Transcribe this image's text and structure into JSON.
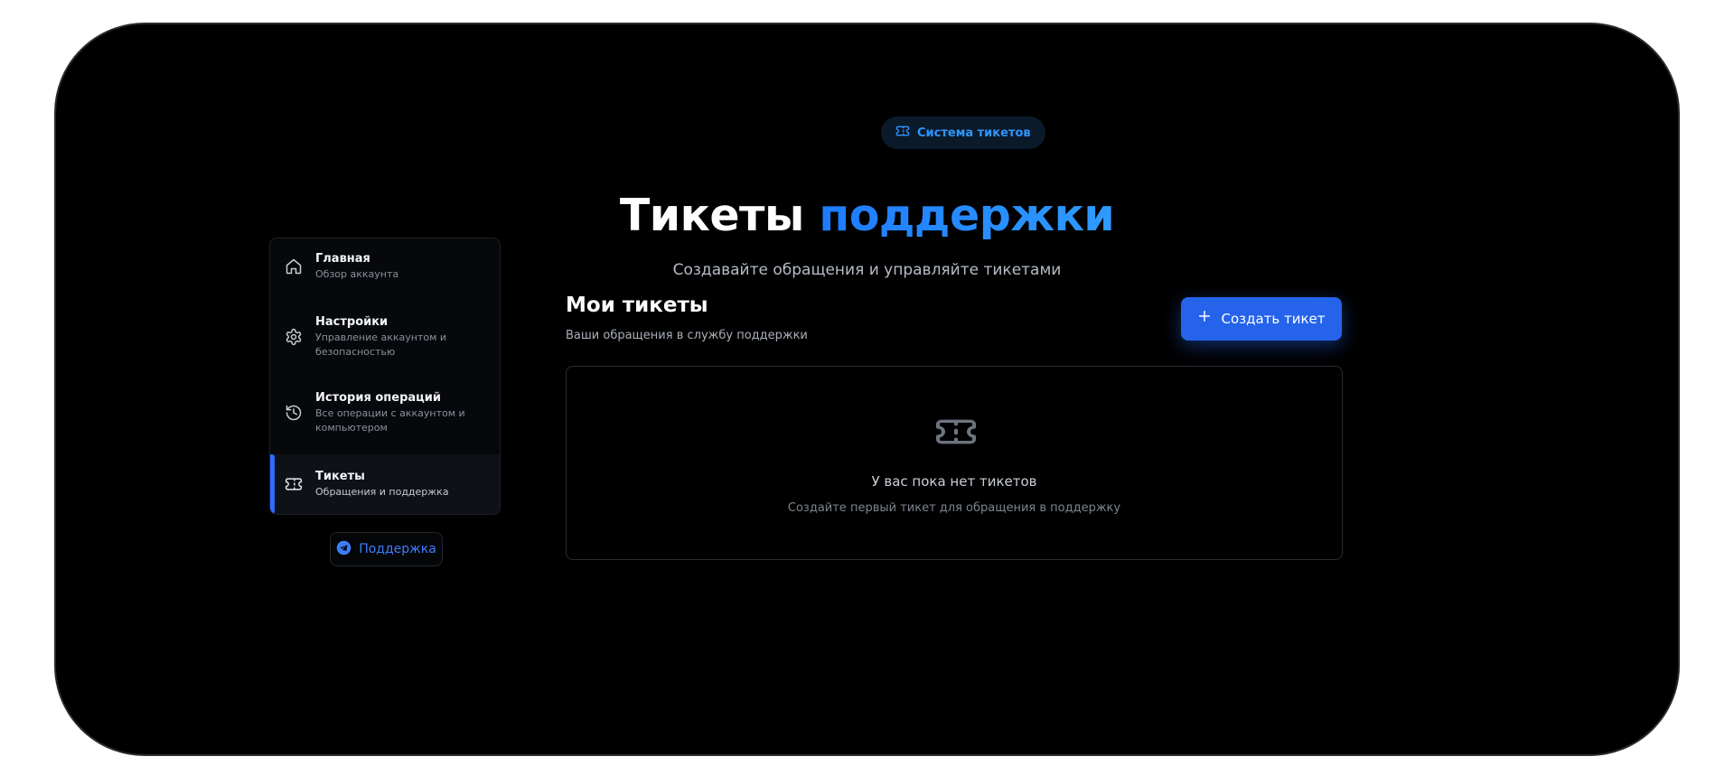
{
  "header": {
    "badge_label": "Система тикетов",
    "title_part1": "Тикеты",
    "title_part2": "поддержки",
    "subtitle": "Создавайте обращения и управляйте тикетами"
  },
  "sidebar": {
    "items": [
      {
        "title": "Главная",
        "desc": "Обзор аккаунта",
        "icon": "home-icon",
        "active": false
      },
      {
        "title": "Настройки",
        "desc": "Управление аккаунтом и безопасностью",
        "icon": "gear-icon",
        "active": false
      },
      {
        "title": "История операций",
        "desc": "Все операции с аккаунтом и компьютером",
        "icon": "history-icon",
        "active": false
      },
      {
        "title": "Тикеты",
        "desc": "Обращения и поддержка",
        "icon": "ticket-icon",
        "active": true
      }
    ],
    "support_label": "Поддержка",
    "support_icon": "telegram-icon"
  },
  "main": {
    "title": "Мои тикеты",
    "subtitle": "Ваши обращения в службу поддержки",
    "create_button_label": "Создать тикет",
    "create_button_icon": "plus-icon",
    "empty": {
      "icon": "ticket-icon",
      "title": "У вас пока нет тикетов",
      "subtitle": "Создайте первый тикет для обращения в поддержку"
    }
  },
  "colors": {
    "background": "#000000",
    "accent": "#2563eb",
    "accent_text": "#2f95ff",
    "active_indicator": "#2f6bff"
  }
}
